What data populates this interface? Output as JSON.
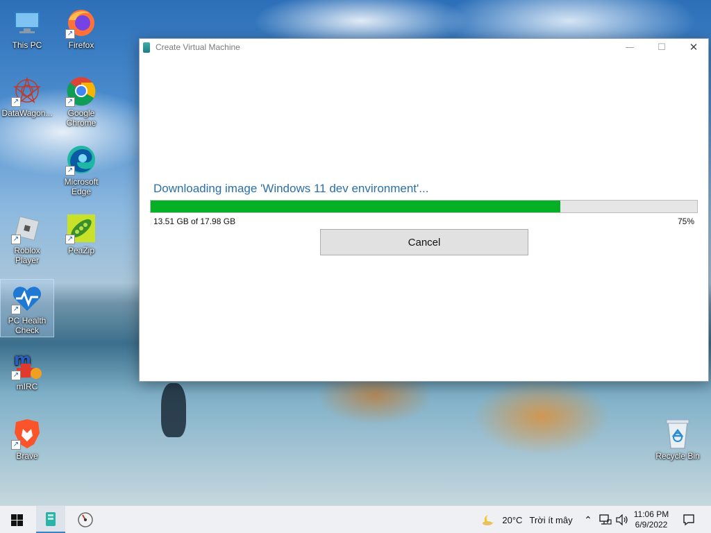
{
  "desktop": {
    "icons": [
      {
        "label": "This PC",
        "icon": "this-pc-icon"
      },
      {
        "label": "Firefox",
        "icon": "firefox-icon"
      },
      {
        "label": "DataWagon...",
        "icon": "datawagon-icon"
      },
      {
        "label": "Google Chrome",
        "icon": "chrome-icon"
      },
      {
        "label": "Microsoft Edge",
        "icon": "edge-icon"
      },
      {
        "label": "Roblox Player",
        "icon": "roblox-icon"
      },
      {
        "label": "PeaZip",
        "icon": "peazip-icon"
      },
      {
        "label": "PC Health Check",
        "icon": "pc-health-check-icon"
      },
      {
        "label": "mIRC",
        "icon": "mirc-icon"
      },
      {
        "label": "Brave",
        "icon": "brave-icon"
      },
      {
        "label": "Recycle Bin",
        "icon": "recycle-bin-icon"
      }
    ]
  },
  "window": {
    "title": "Create Virtual Machine",
    "status": "Downloading image 'Windows 11 dev environment'...",
    "progress": {
      "fraction": 0.75,
      "size_text": "13.51 GB of 17.98 GB",
      "percent_text": "75%"
    },
    "cancel_label": "Cancel",
    "controls": {
      "minimize": "—",
      "maximize": "☐",
      "close": "✕"
    }
  },
  "taskbar": {
    "weather": {
      "temp": "20°C",
      "desc": "Trời ít mây"
    },
    "clock": {
      "time": "11:06 PM",
      "date": "6/9/2022"
    }
  },
  "colors": {
    "progress_fill": "#06b025",
    "status_text": "#2a6fa8"
  }
}
